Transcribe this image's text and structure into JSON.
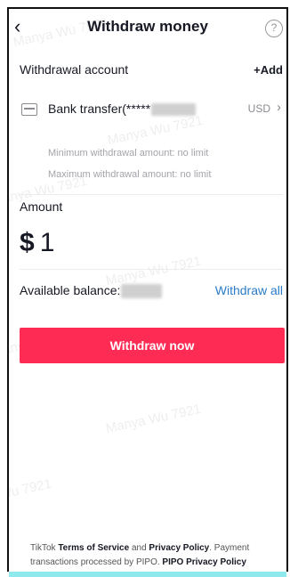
{
  "header": {
    "back_icon": "back-chevron-icon",
    "title": "Withdraw money",
    "help_glyph": "?"
  },
  "account": {
    "section_title": "Withdrawal account",
    "add_label": "+Add",
    "bank_label": "Bank transfer(*****",
    "currency": "USD",
    "min_limit": "Minimum withdrawal amount: no limit",
    "max_limit": "Maximum withdrawal amount: no limit"
  },
  "amount": {
    "label": "Amount",
    "symbol": "$",
    "value": "1"
  },
  "balance": {
    "label": "Available balance:",
    "withdraw_all": "Withdraw all"
  },
  "withdraw_button": "Withdraw now",
  "footer": {
    "prefix": "TikTok",
    "terms": "Terms of Service",
    "and": "and",
    "privacy": "Privacy Policy",
    "mid": ". Payment transactions processed by PIPO.",
    "pipo_privacy": "PIPO Privacy Policy"
  },
  "watermark_text": "Manya Wu 7921",
  "colors": {
    "accent": "#fe2c55",
    "link": "#2a7cc7",
    "muted": "#a3a4aa"
  }
}
